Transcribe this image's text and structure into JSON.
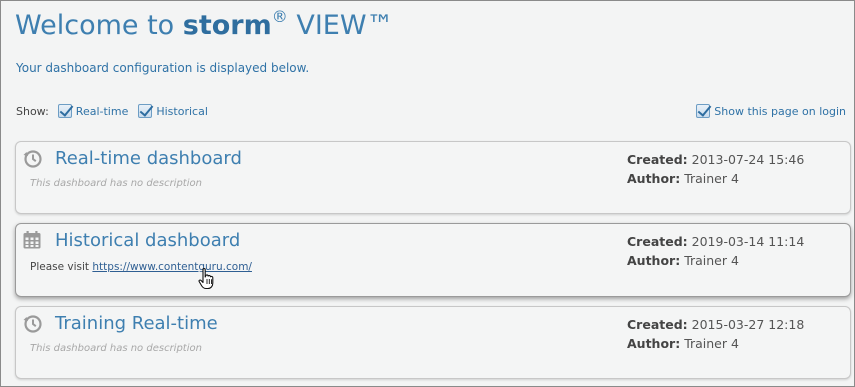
{
  "header": {
    "title_prefix": "Welcome to ",
    "title_brand": "storm",
    "title_reg": "®",
    "title_suffix": " VIEW™",
    "subtitle": "Your dashboard configuration is displayed below."
  },
  "filters": {
    "show_label": "Show:",
    "options": [
      {
        "label": "Real-time",
        "checked": true
      },
      {
        "label": "Historical",
        "checked": true
      }
    ],
    "show_on_login": {
      "label": "Show this page on login",
      "checked": true
    }
  },
  "dashboards": [
    {
      "icon": "clock-history-icon",
      "title": "Real-time dashboard",
      "description": "This dashboard has no description",
      "created_label": "Created",
      "created": "2013-07-24 15:46",
      "author_label": "Author",
      "author": "Trainer 4"
    },
    {
      "icon": "calendar-icon",
      "title": "Historical dashboard",
      "description_prefix": "Please visit ",
      "description_link": "https://www.contentguru.com/",
      "created_label": "Created",
      "created": "2019-03-14 11:14",
      "author_label": "Author",
      "author": "Trainer 4"
    },
    {
      "icon": "clock-history-icon",
      "title": "Training Real-time",
      "description": "This dashboard has no description",
      "created_label": "Created",
      "created": "2015-03-27 12:18",
      "author_label": "Author",
      "author": "Trainer 4"
    }
  ],
  "colors": {
    "accent": "#3e7fb0",
    "link": "#2f5f93",
    "muted": "#a8a8a8"
  }
}
